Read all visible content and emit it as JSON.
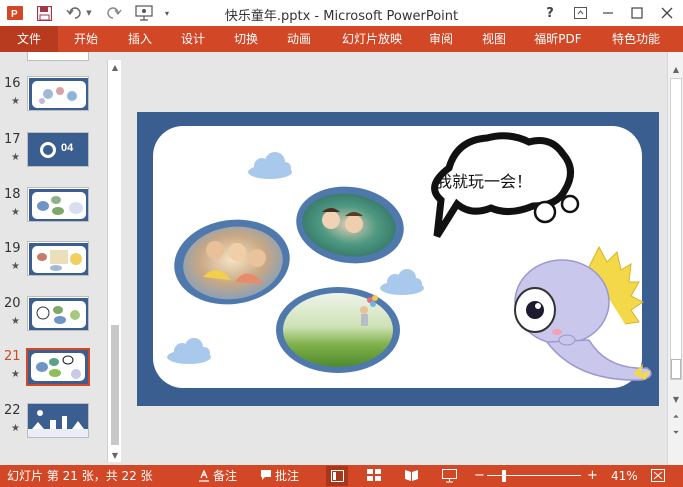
{
  "window": {
    "title": "快乐童年.pptx - Microsoft PowerPoint",
    "help": "?",
    "controls": [
      "ribbon-display",
      "minimize",
      "maximize",
      "close"
    ]
  },
  "ribbon": {
    "tabs": [
      "文件",
      "开始",
      "插入",
      "设计",
      "切换",
      "动画",
      "幻灯片放映",
      "审阅",
      "视图",
      "福昕PDF",
      "特色功能"
    ]
  },
  "thumbnails": [
    {
      "number": "16",
      "active": false
    },
    {
      "number": "17",
      "active": false,
      "caption": "04"
    },
    {
      "number": "18",
      "active": false
    },
    {
      "number": "19",
      "active": false
    },
    {
      "number": "20",
      "active": false
    },
    {
      "number": "21",
      "active": true
    },
    {
      "number": "22",
      "active": false
    }
  ],
  "slide": {
    "speech_bubble_text": "我就玩一会！"
  },
  "statusbar": {
    "slide_info": "幻灯片 第 21 张，共 22 张",
    "notes_label": "备注",
    "comments_label": "批注",
    "zoom": "41%"
  },
  "colors": {
    "accent": "#d24726",
    "slide_frame": "#3a5e8f"
  }
}
